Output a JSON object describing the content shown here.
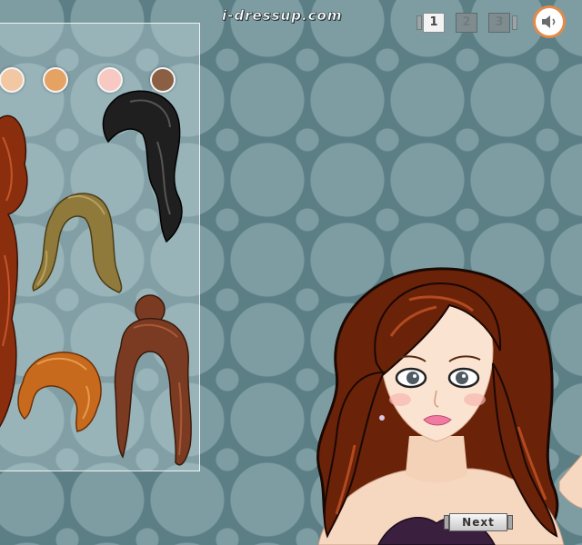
{
  "header": {
    "site_name": "i-dressup.com"
  },
  "steps": [
    {
      "label": "1",
      "active": true
    },
    {
      "label": "2",
      "active": false
    },
    {
      "label": "3",
      "active": false
    }
  ],
  "sound_icon": "speaker-icon",
  "swatches": [
    "#f2c7a4",
    "#e6a263",
    "#f8c9c2",
    "#8a5f43"
  ],
  "hair_colors": {
    "auburn": "#8a2e0e",
    "black": "#1f1f1f",
    "olive": "#8f7a3c",
    "copper": "#c86a1e",
    "chestnut": "#7a3b22",
    "model": "#6a2208"
  },
  "next_button": {
    "label": "Next"
  }
}
